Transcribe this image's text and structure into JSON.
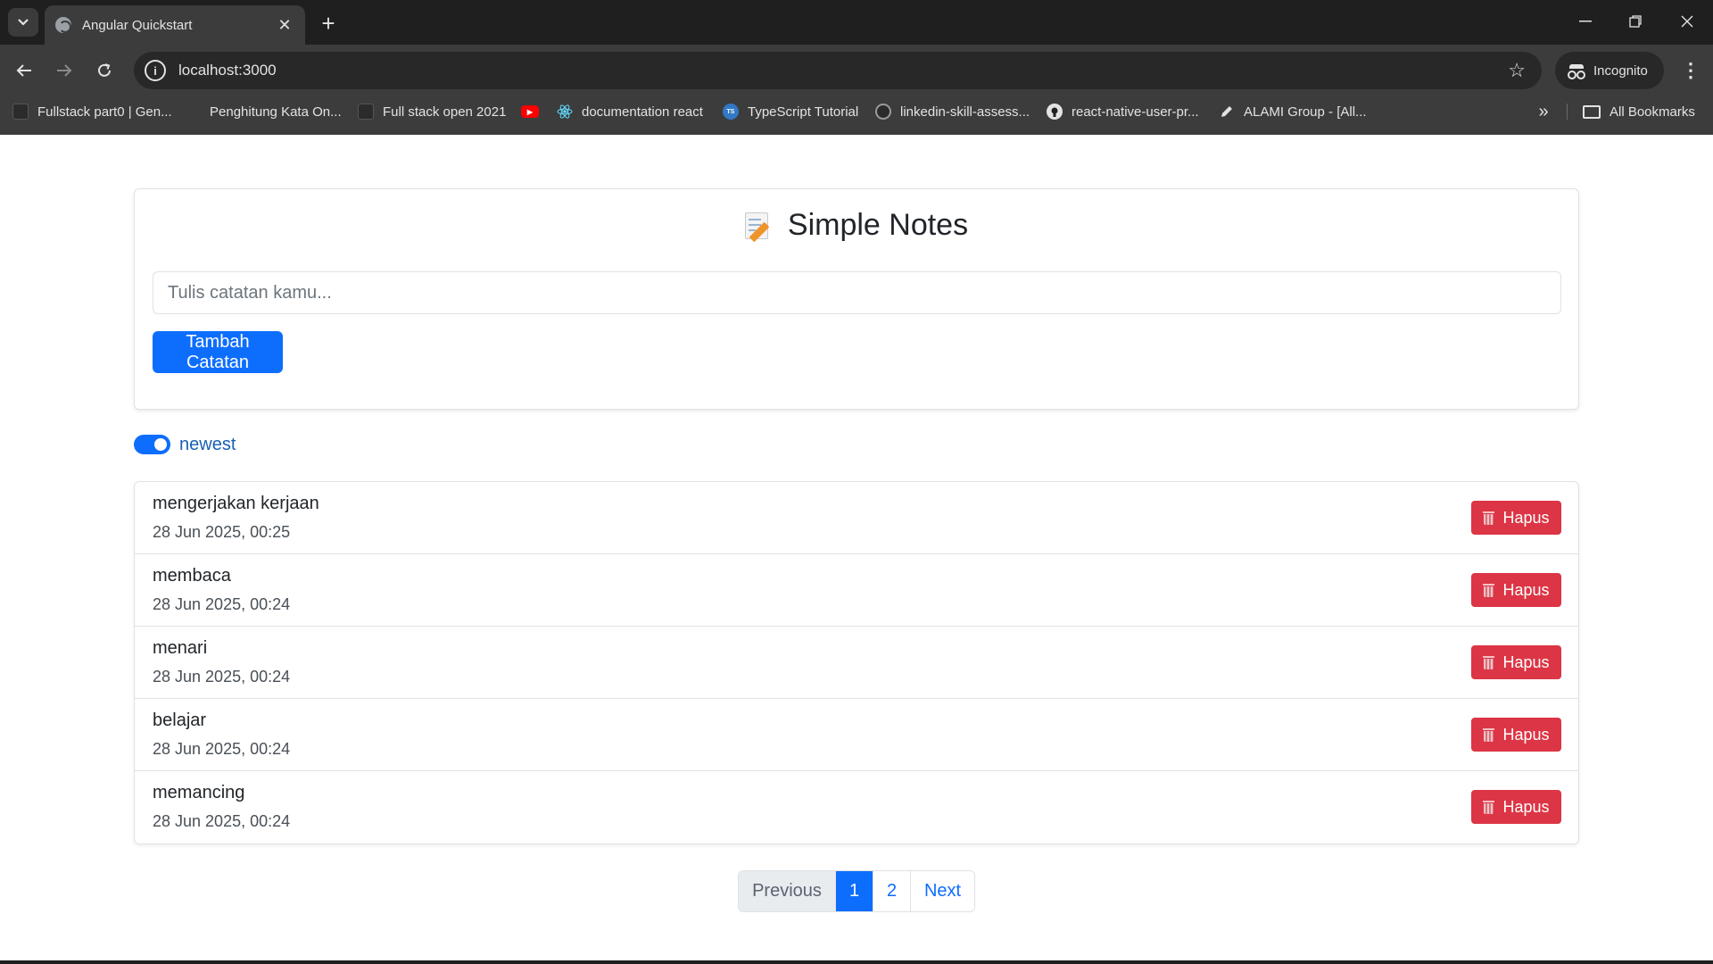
{
  "browser": {
    "tab_title": "Angular Quickstart",
    "url": "localhost:3000",
    "incognito_label": "Incognito",
    "bookmarks": [
      {
        "label": "Fullstack part0 | Gen...",
        "icon": "page-icon"
      },
      {
        "label": "Penghitung Kata On...",
        "icon": "page-icon"
      },
      {
        "label": "Full stack open 2021",
        "icon": "page-icon"
      },
      {
        "label": "",
        "icon": "youtube-icon"
      },
      {
        "label": "documentation react",
        "icon": "react-icon"
      },
      {
        "label": "TypeScript Tutorial",
        "icon": "typescript-icon"
      },
      {
        "label": "linkedin-skill-assess...",
        "icon": "github-icon"
      },
      {
        "label": "react-native-user-pr...",
        "icon": "github-icon"
      },
      {
        "label": "ALAMI Group - [All...",
        "icon": "pen-icon"
      }
    ],
    "all_bookmarks_label": "All Bookmarks"
  },
  "app": {
    "title": "Simple Notes",
    "input_placeholder": "Tulis catatan kamu...",
    "input_value": "",
    "add_button_label": "Tambah Catatan",
    "sort_toggle_label": "newest",
    "sort_toggle_on": true,
    "delete_button_label": "Hapus",
    "notes": [
      {
        "text": "mengerjakan kerjaan",
        "date": "28 Jun 2025, 00:25"
      },
      {
        "text": "membaca",
        "date": "28 Jun 2025, 00:24"
      },
      {
        "text": "menari",
        "date": "28 Jun 2025, 00:24"
      },
      {
        "text": "belajar",
        "date": "28 Jun 2025, 00:24"
      },
      {
        "text": "memancing",
        "date": "28 Jun 2025, 00:24"
      }
    ],
    "pagination": {
      "previous_label": "Previous",
      "pages": [
        "1",
        "2"
      ],
      "current_page": "1",
      "next_label": "Next"
    }
  },
  "colors": {
    "primary": "#0d6efd",
    "danger": "#dc3545",
    "chrome_dark": "#1f1f1f",
    "chrome_toolbar": "#3c3c3c"
  }
}
